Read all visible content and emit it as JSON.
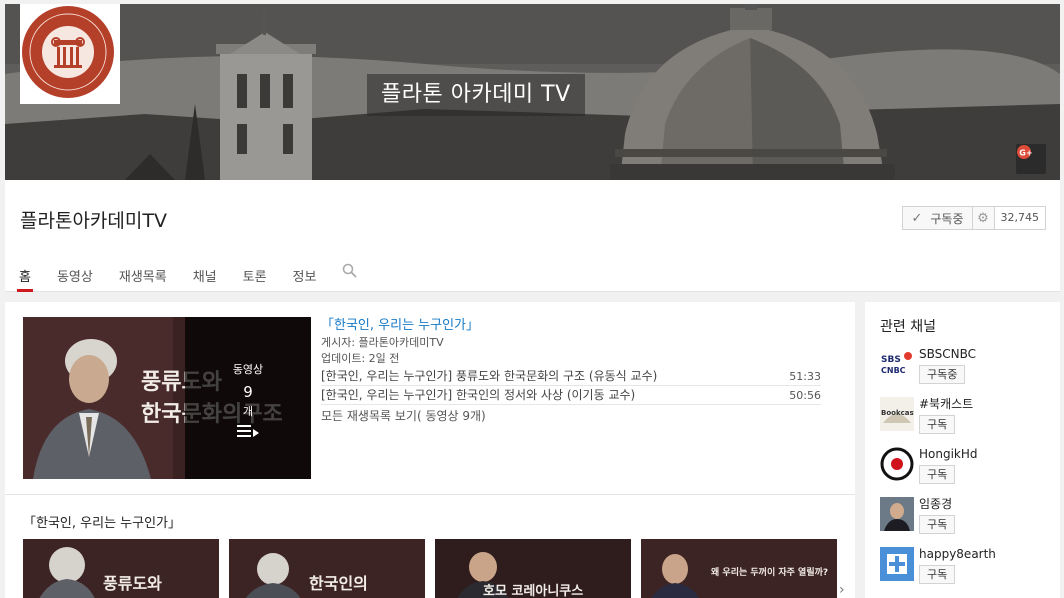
{
  "banner": {
    "title": "플라톤 아카데미 TV",
    "logo_text": "FOUNDATION ACADEMIA PLATONICA 재단법인 플라톤 아카데미"
  },
  "channel": {
    "name": "플라톤아카데미TV",
    "subscribe_label": "구독중",
    "subscriber_count": "32,745"
  },
  "tabs": [
    {
      "label": "홈",
      "active": true
    },
    {
      "label": "동영상"
    },
    {
      "label": "재생목록"
    },
    {
      "label": "채널"
    },
    {
      "label": "토론"
    },
    {
      "label": "정보"
    }
  ],
  "featured": {
    "title": "「한국인, 우리는 누구인가」",
    "author": "게시자: 플라톤아카데미TV",
    "updated": "업데이트: 2일 전",
    "overlay_label": "동영상",
    "overlay_count": "9",
    "overlay_unit": "개",
    "thumb_text_1": "풍류도와",
    "thumb_text_2": "한국문화의구조",
    "videos": [
      {
        "title": "[한국인, 우리는 누구인가] 풍류도와 한국문화의 구조 (유동식 교수)",
        "duration": "51:33"
      },
      {
        "title": "[한국인, 우리는 누구인가] 한국인의 정서와 사상 (이기동 교수)",
        "duration": "50:56"
      }
    ],
    "view_all": "모든 재생목록 보기( 동영상 9개)"
  },
  "shelf": {
    "title": "「한국인, 우리는 누구인가」",
    "thumbs": [
      {
        "text": "풍류도와"
      },
      {
        "text": "한국인의"
      },
      {
        "text": "호모 코레아니쿠스"
      },
      {
        "text": "왜 우리는 두꺼이 자주 열릴까?"
      }
    ]
  },
  "sidebar": {
    "title": "관련 채널",
    "channels": [
      {
        "name": "SBSCNBC",
        "button": "구독중",
        "avatar_text": "SBS CNBC"
      },
      {
        "name": "#북캐스트",
        "button": "구독",
        "avatar_text": "Bookcast"
      },
      {
        "name": "HongikHd",
        "button": "구독"
      },
      {
        "name": "임종경",
        "button": "구독"
      },
      {
        "name": "happy8earth",
        "button": "구독"
      }
    ]
  },
  "colors": {
    "accent": "#cc181e",
    "link": "#167ac6",
    "logo": "#b5402a"
  }
}
